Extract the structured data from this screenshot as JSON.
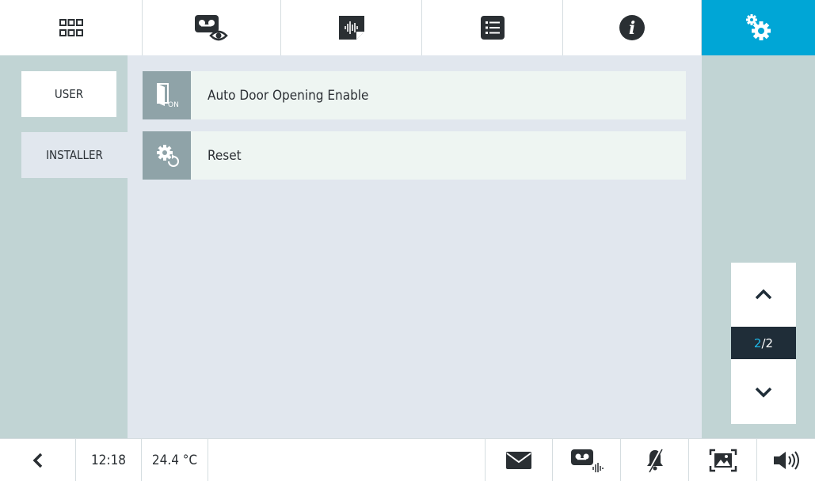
{
  "top_tabs": [
    {
      "name": "menu-grid",
      "icon": "grid-icon",
      "active": false
    },
    {
      "name": "video-memory",
      "icon": "video-memory-eye-icon",
      "active": false
    },
    {
      "name": "audio-messages",
      "icon": "audio-message-icon",
      "active": false
    },
    {
      "name": "list",
      "icon": "list-icon",
      "active": false
    },
    {
      "name": "info",
      "icon": "info-icon",
      "active": false
    },
    {
      "name": "settings",
      "icon": "settings-gears-icon",
      "active": true
    }
  ],
  "sidebar": {
    "items": [
      {
        "label": "USER",
        "selected": false
      },
      {
        "label": "INSTALLER",
        "selected": true
      }
    ]
  },
  "settings_list": [
    {
      "label": "Auto Door Opening Enable",
      "icon": "door-on-icon"
    },
    {
      "label": "Reset",
      "icon": "gear-reset-icon"
    }
  ],
  "pager": {
    "current": "2",
    "separator": "/",
    "total": "2"
  },
  "status_bar": {
    "time": "12:18",
    "temperature": "24.4 °C"
  },
  "colors": {
    "accent": "#00a6d6",
    "sidebar_bg": "#c1d4d4",
    "content_bg": "#e1e7ee",
    "row_bg": "#eef5f2",
    "row_icon_bg": "#8fa3a8",
    "pager_indicator_bg": "#1f2d38",
    "pager_current_color": "#1fb8e8"
  }
}
